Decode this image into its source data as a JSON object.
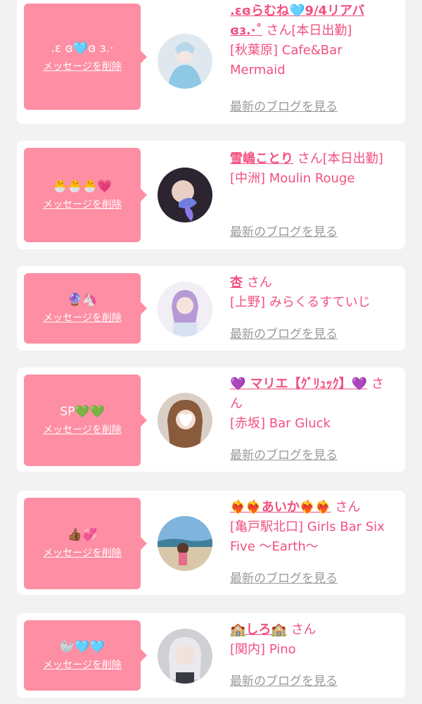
{
  "colors": {
    "background": "#f2f2f2",
    "card": "#ffffff",
    "message_box": "#fd8ea3",
    "accent_text": "#f2507f",
    "muted_link": "#9a9a9a"
  },
  "delete_label": "メッセージを削除",
  "blog_label": "最新のブログを見る",
  "honorific": "さん",
  "items": [
    {
      "message": ".ɛ ɞ🩵ɞ ɜ.·",
      "name": ".ɛɞらむね🩵9/4リアバɞɜ.·˚",
      "status": "[本日出勤]",
      "place": "[秋葉原] Cafe&Bar Mermaid"
    },
    {
      "message": "🐣🐣🐣💗",
      "name": "雪嶋ことり",
      "status": "[本日出勤]",
      "place": "[中洲] Moulin Rouge"
    },
    {
      "message": "🔮🦄",
      "name": "杏",
      "status": "",
      "place": "[上野] みらくるすていじ"
    },
    {
      "message": "SP💚💚",
      "name": "💜 マリエ【ｸﾞﾘｭｯｸ】💜",
      "status": "",
      "place": "[赤坂] Bar Gluck"
    },
    {
      "message": "👍🏾💞",
      "name": "❤️‍🔥❤️‍🔥あいか❤️‍🔥❤️‍🔥",
      "status": "",
      "place": "[亀戸駅北口] Girls Bar Six Five 〜Earth〜"
    },
    {
      "message": "🦭🩵🩵",
      "name": "🏫しろ🏫",
      "status": "",
      "place": "[関内] Pino"
    }
  ]
}
